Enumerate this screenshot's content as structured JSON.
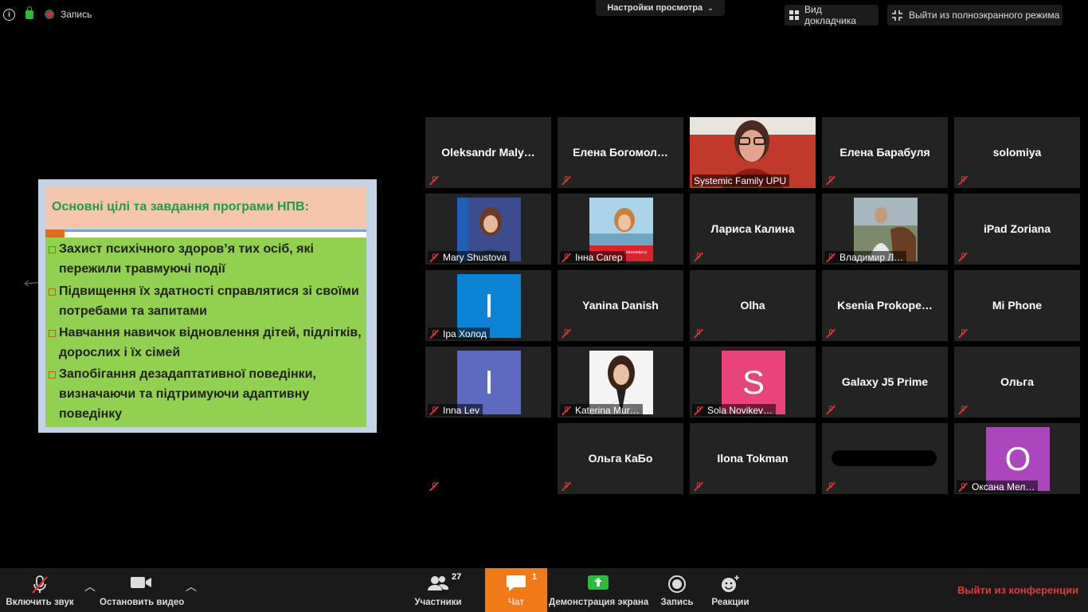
{
  "topbar": {
    "record_label": "Запись",
    "view_settings": "Настройки просмотра",
    "speaker_view": "Вид докладчика",
    "exit_fullscreen": "Выйти из полноэкранного режима"
  },
  "slide": {
    "title": "Основні цілі та завдання програми НПВ:",
    "bullets": [
      " Захист психічного здоров’я  тих осіб, які пережили травмуючі події",
      "Підвищення їх здатності справлятися  зі своїми потребами та запитами",
      "Навчання  навичок відновлення дітей, підлітків, дорослих і їх сімей",
      "Запобігання дезадаптативної поведінки, визначаючи та підтримуючи адаптивну поведінку"
    ]
  },
  "participants": [
    {
      "name": "Oleksandr  Maly…"
    },
    {
      "name": "Елена  Богомол…"
    },
    {
      "label": "Systemic Family UPU",
      "kind": "video"
    },
    {
      "name": "Елена Барабуля"
    },
    {
      "name": "solomiya"
    },
    {
      "label": "Mary Shustova",
      "kind": "photo"
    },
    {
      "label": "Інна Сагер",
      "kind": "photo"
    },
    {
      "name": "Лариса Калина"
    },
    {
      "label": "Владимир Л…",
      "kind": "photo"
    },
    {
      "name": "iPad Zoriana"
    },
    {
      "label": "Іра Холод",
      "initial": "I",
      "color": "#0a84d4"
    },
    {
      "name": "Yanina Danish"
    },
    {
      "name": "Olha"
    },
    {
      "name": "Ksenia  Prokope…"
    },
    {
      "name": "Mi Phone"
    },
    {
      "label": "Inna Lev",
      "initial": "I",
      "color": "#5c6bc0"
    },
    {
      "label": "Katerina Mur…",
      "kind": "photo"
    },
    {
      "label": "Sola Novikev…",
      "initial": "S",
      "color": "#e8437a"
    },
    {
      "name": "Galaxy J5 Prime"
    },
    {
      "name": "Ольга"
    },
    {
      "name": "",
      "redacted": true
    },
    {
      "name": "Ольга КаБо"
    },
    {
      "name": "Ilona Tokman"
    },
    {
      "name": "",
      "redacted": true
    },
    {
      "label": "Оксана Мел…",
      "initial": "O",
      "color": "#ab47bc"
    }
  ],
  "toolbar": {
    "unmute": "Включить звук",
    "stop_video": "Остановить видео",
    "participants": "Участники",
    "participants_count": "27",
    "chat": "Чат",
    "chat_count": "1",
    "share_screen": "Демонстрация экрана",
    "record": "Запись",
    "reactions": "Реакции",
    "leave": "Выйти из конференции"
  },
  "colors": {
    "chat_active": "#f07a17",
    "leave": "#e23b3b",
    "mute_red": "#e03030",
    "share_green": "#2dbb39"
  }
}
